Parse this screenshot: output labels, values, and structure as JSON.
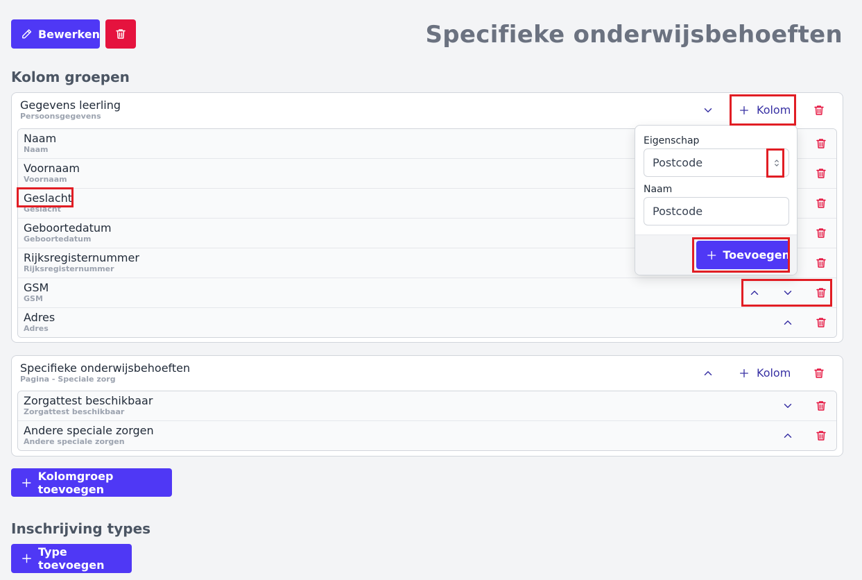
{
  "header": {
    "edit_label": "Bewerken",
    "page_title": "Specifieke onderwijsbehoeften"
  },
  "sections": {
    "column_groups_title": "Kolom groepen",
    "enrollment_types_title": "Inschrijving types"
  },
  "groups": [
    {
      "name": "Gegevens leerling",
      "subtitle": "Persoonsgegevens",
      "add_column_label": "Kolom",
      "rows": [
        {
          "name": "Naam",
          "subtitle": "Naam"
        },
        {
          "name": "Voornaam",
          "subtitle": "Voornaam"
        },
        {
          "name": "Geslacht",
          "subtitle": "Geslacht"
        },
        {
          "name": "Geboortedatum",
          "subtitle": "Geboortedatum"
        },
        {
          "name": "Rijksregisternummer",
          "subtitle": "Rijksregisternummer"
        },
        {
          "name": "GSM",
          "subtitle": "GSM"
        },
        {
          "name": "Adres",
          "subtitle": "Adres"
        }
      ]
    },
    {
      "name": "Specifieke onderwijsbehoeften",
      "subtitle": "Pagina - Speciale zorg",
      "add_column_label": "Kolom",
      "rows": [
        {
          "name": "Zorgattest beschikbaar",
          "subtitle": "Zorgattest beschikbaar"
        },
        {
          "name": "Andere speciale zorgen",
          "subtitle": "Andere speciale zorgen"
        }
      ]
    }
  ],
  "popover": {
    "property_label": "Eigenschap",
    "property_value": "Postcode",
    "name_label": "Naam",
    "name_value": "Postcode",
    "submit_label": "Toevoegen"
  },
  "actions": {
    "add_group_label": "Kolomgroep toevoegen",
    "add_type_label": "Type toevoegen"
  },
  "colors": {
    "primary": "#4f38f5",
    "danger": "#e5133e",
    "highlight": "#e11d24"
  }
}
